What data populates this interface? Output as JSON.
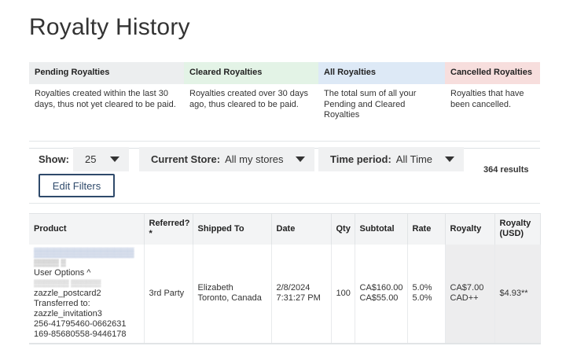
{
  "page": {
    "title": "Royalty History"
  },
  "legend": [
    {
      "title": "Pending Royalties",
      "text": "Royalties created within the last 30 days, thus not yet cleared to be paid."
    },
    {
      "title": "Cleared Royalties",
      "text": "Royalties created over 30 days ago, thus cleared to be paid."
    },
    {
      "title": "All Royalties",
      "text": "The total sum of all your Pending and Cleared Royalties"
    },
    {
      "title": "Cancelled Royalties",
      "text": "Royalties that have been cancelled."
    }
  ],
  "filters": {
    "show_label": "Show:",
    "show_value": "25",
    "store_label": "Current Store:",
    "store_value": "All my stores",
    "period_label": "Time period:",
    "period_value": "All Time",
    "results": "364 results",
    "edit_button": "Edit Filters"
  },
  "table": {
    "headers": {
      "product": "Product",
      "referred": "Referred? *",
      "shipped_to": "Shipped To",
      "date": "Date",
      "qty": "Qty",
      "subtotal": "Subtotal",
      "rate": "Rate",
      "royalty": "Royalty",
      "royalty_usd": "Royalty (USD)"
    },
    "rows": [
      {
        "product_user_options": "User Options ^",
        "product_line1": "zazzle_postcard2",
        "product_line2": "Transferred to:",
        "product_line3": "zazzle_invitation3",
        "product_line4": "256-41795460-0662631",
        "product_line5": "169-85680558-9446178",
        "referred": "3rd Party",
        "shipped_name": "Elizabeth",
        "shipped_place": "Toronto, Canada",
        "date": "2/8/2024",
        "time": "7:31:27 PM",
        "qty": "100",
        "subtotal1": "CA$160.00",
        "subtotal2": "CA$55.00",
        "rate1": "5.0%",
        "rate2": "5.0%",
        "royalty1": "CA$7.00",
        "royalty2": "CAD++",
        "royalty_usd": "$4.93**"
      }
    ]
  }
}
